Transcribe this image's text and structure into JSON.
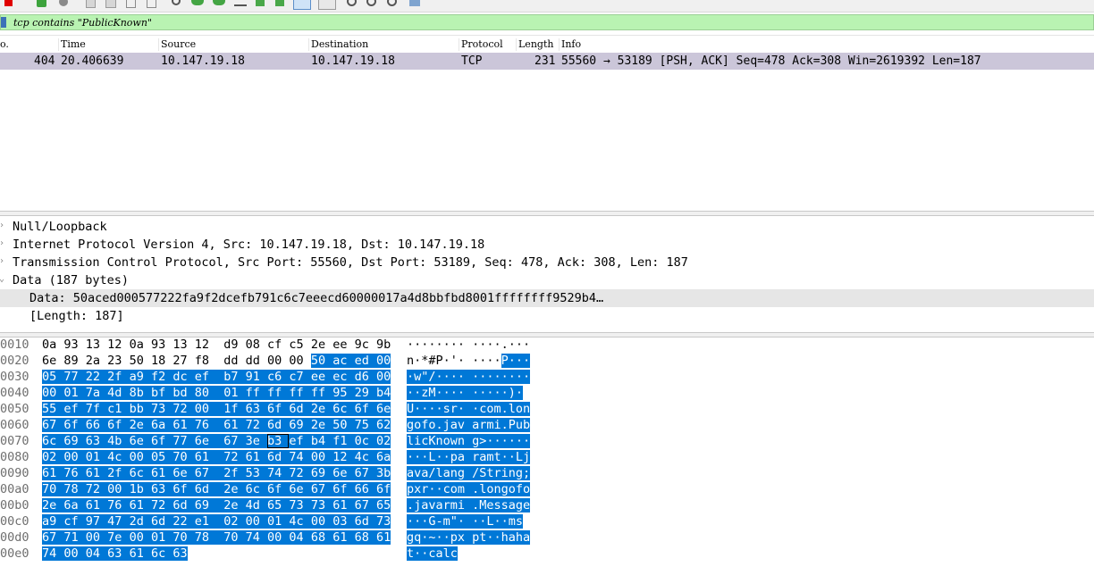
{
  "toolbar": {
    "icons": [
      "stop-capture-icon",
      "restart-capture-icon",
      "capture-options-icon",
      "open-file-icon",
      "save-file-icon",
      "close-file-icon",
      "reload-icon",
      "find-packet-icon",
      "go-back-icon",
      "go-forward-icon",
      "go-to-packet-icon",
      "go-first-icon",
      "go-last-icon",
      "autoscroll-icon",
      "colorize-icon",
      "zoom-in-icon",
      "zoom-out-icon",
      "zoom-normal-icon",
      "resize-columns-icon"
    ]
  },
  "filter": {
    "value": "tcp contains \"PublicKnown\"",
    "accent": "#b9f3b2"
  },
  "columns": [
    "o.",
    "Time",
    "Source",
    "Destination",
    "Protocol",
    "Length",
    "Info"
  ],
  "packet": {
    "no": "404",
    "time": "20.406639",
    "source": "10.147.19.18",
    "destination": "10.147.19.18",
    "protocol": "TCP",
    "length": "231",
    "info": "55560 → 53189 [PSH, ACK] Seq=478 Ack=308 Win=2619392 Len=187"
  },
  "details": [
    {
      "label": "Null/Loopback",
      "expanded": false
    },
    {
      "label": "Internet Protocol Version 4, Src: 10.147.19.18, Dst: 10.147.19.18",
      "expanded": false
    },
    {
      "label": "Transmission Control Protocol, Src Port: 55560, Dst Port: 53189, Seq: 478, Ack: 308, Len: 187",
      "expanded": false
    },
    {
      "label": "Data (187 bytes)",
      "expanded": true
    },
    {
      "label": "Data: 50aced000577222fa9f2dcefb791c6c7eeecd60000017a4d8bbfbd8001ffffffff9529b4…",
      "selected": true
    },
    {
      "label": "[Length: 187]"
    }
  ],
  "bytes": [
    {
      "offset": "0010",
      "hex": [
        "0a",
        "93",
        "13",
        "12",
        "0a",
        "93",
        "13",
        "12",
        "d9",
        "08",
        "cf",
        "c5",
        "2e",
        "ee",
        "9c",
        "9b"
      ],
      "ascii": "········ ····.···",
      "hl": 16
    },
    {
      "offset": "0020",
      "hex": [
        "6e",
        "89",
        "2a",
        "23",
        "50",
        "18",
        "27",
        "f8",
        "dd",
        "dd",
        "00",
        "00",
        "50",
        "ac",
        "ed",
        "00"
      ],
      "ascii": "n·*#P·'· ····P···",
      "hl": 12
    },
    {
      "offset": "0030",
      "hex": [
        "05",
        "77",
        "22",
        "2f",
        "a9",
        "f2",
        "dc",
        "ef",
        "b7",
        "91",
        "c6",
        "c7",
        "ee",
        "ec",
        "d6",
        "00"
      ],
      "ascii": "·w\"/···· ········",
      "hl": 0
    },
    {
      "offset": "0040",
      "hex": [
        "00",
        "01",
        "7a",
        "4d",
        "8b",
        "bf",
        "bd",
        "80",
        "01",
        "ff",
        "ff",
        "ff",
        "ff",
        "95",
        "29",
        "b4"
      ],
      "ascii": "··zM···· ·····)·",
      "hl": 0
    },
    {
      "offset": "0050",
      "hex": [
        "55",
        "ef",
        "7f",
        "c1",
        "bb",
        "73",
        "72",
        "00",
        "1f",
        "63",
        "6f",
        "6d",
        "2e",
        "6c",
        "6f",
        "6e"
      ],
      "ascii": "U····sr· ·com.lon",
      "hl": 0
    },
    {
      "offset": "0060",
      "hex": [
        "67",
        "6f",
        "66",
        "6f",
        "2e",
        "6a",
        "61",
        "76",
        "61",
        "72",
        "6d",
        "69",
        "2e",
        "50",
        "75",
        "62"
      ],
      "ascii": "gofo.jav armi.Pub",
      "hl": 0
    },
    {
      "offset": "0070",
      "hex": [
        "6c",
        "69",
        "63",
        "4b",
        "6e",
        "6f",
        "77",
        "6e",
        "67",
        "3e",
        "b3",
        "ef",
        "b4",
        "f1",
        "0c",
        "02"
      ],
      "ascii": "licKnown g>······",
      "hl": 0
    },
    {
      "offset": "0080",
      "hex": [
        "02",
        "00",
        "01",
        "4c",
        "00",
        "05",
        "70",
        "61",
        "72",
        "61",
        "6d",
        "74",
        "00",
        "12",
        "4c",
        "6a"
      ],
      "ascii": "···L··pa ramt··Lj",
      "hl": 0
    },
    {
      "offset": "0090",
      "hex": [
        "61",
        "76",
        "61",
        "2f",
        "6c",
        "61",
        "6e",
        "67",
        "2f",
        "53",
        "74",
        "72",
        "69",
        "6e",
        "67",
        "3b"
      ],
      "ascii": "ava/lang /String;",
      "hl": 0
    },
    {
      "offset": "00a0",
      "hex": [
        "70",
        "78",
        "72",
        "00",
        "1b",
        "63",
        "6f",
        "6d",
        "2e",
        "6c",
        "6f",
        "6e",
        "67",
        "6f",
        "66",
        "6f"
      ],
      "ascii": "pxr··com .longofo",
      "hl": 0
    },
    {
      "offset": "00b0",
      "hex": [
        "2e",
        "6a",
        "61",
        "76",
        "61",
        "72",
        "6d",
        "69",
        "2e",
        "4d",
        "65",
        "73",
        "73",
        "61",
        "67",
        "65"
      ],
      "ascii": ".javarmi .Message",
      "hl": 0
    },
    {
      "offset": "00c0",
      "hex": [
        "a9",
        "cf",
        "97",
        "47",
        "2d",
        "6d",
        "22",
        "e1",
        "02",
        "00",
        "01",
        "4c",
        "00",
        "03",
        "6d",
        "73"
      ],
      "ascii": "···G-m\"· ··L··ms",
      "hl": 0
    },
    {
      "offset": "00d0",
      "hex": [
        "67",
        "71",
        "00",
        "7e",
        "00",
        "01",
        "70",
        "78",
        "70",
        "74",
        "00",
        "04",
        "68",
        "61",
        "68",
        "61"
      ],
      "ascii": "gq·~··px pt··haha",
      "hl": 0
    },
    {
      "offset": "00e0",
      "hex": [
        "74",
        "00",
        "04",
        "63",
        "61",
        "6c",
        "63"
      ],
      "ascii": "t··calc",
      "hl": 0
    }
  ]
}
